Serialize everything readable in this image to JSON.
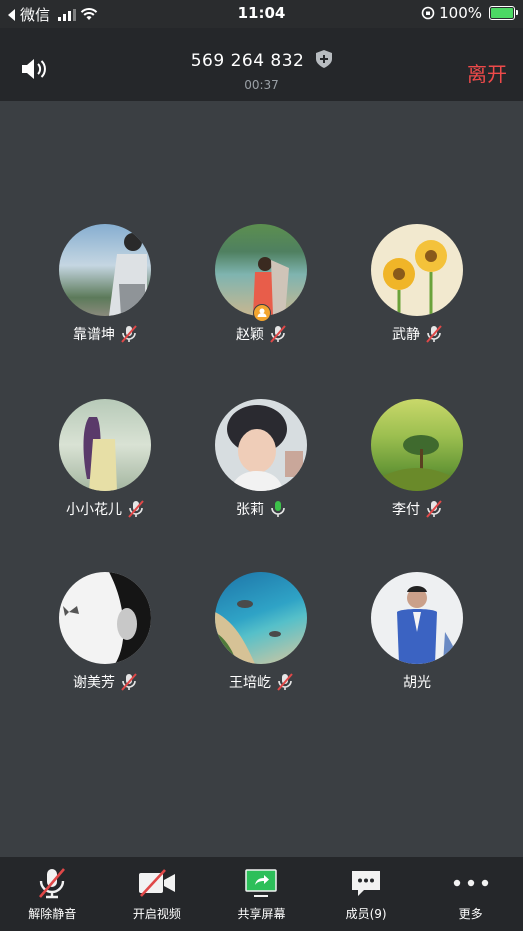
{
  "status_bar": {
    "back_label": "微信",
    "time": "11:04",
    "battery": "100%"
  },
  "header": {
    "meeting_id": "569 264 832",
    "duration": "00:37",
    "leave_label": "离开"
  },
  "participants": [
    {
      "name": "靠谱坤",
      "mic": "muted",
      "avatar_colors": [
        "#7fa6c8",
        "#d9dde0"
      ]
    },
    {
      "name": "赵颖",
      "mic": "muted",
      "host": true,
      "avatar_colors": [
        "#3e8f7d",
        "#c9b68c"
      ]
    },
    {
      "name": "武静",
      "mic": "muted",
      "avatar_colors": [
        "#f4e6b8",
        "#e8b23a"
      ]
    },
    {
      "name": "小小花儿",
      "mic": "muted",
      "avatar_colors": [
        "#9bb7a8",
        "#e6e4dd"
      ]
    },
    {
      "name": "张莉",
      "mic": "active",
      "avatar_colors": [
        "#2f2f36",
        "#e8c7b2"
      ]
    },
    {
      "name": "李付",
      "mic": "muted",
      "avatar_colors": [
        "#a9c35a",
        "#5f8a34"
      ]
    },
    {
      "name": "谢美芳",
      "mic": "muted",
      "avatar_colors": [
        "#f2f2f2",
        "#1d1d1d"
      ]
    },
    {
      "name": "王培屹",
      "mic": "muted",
      "avatar_colors": [
        "#2e8fb8",
        "#d9c9a3"
      ]
    },
    {
      "name": "胡光",
      "mic": "none",
      "avatar_colors": [
        "#eef0f2",
        "#3a5fb8"
      ]
    }
  ],
  "toolbar": {
    "unmute": "解除静音",
    "start_video": "开启视频",
    "share_screen": "共享屏幕",
    "members": "成员(9)",
    "more": "更多"
  },
  "colors": {
    "background": "#3b3f43",
    "bar": "#25272a",
    "leave": "#ee4a4a",
    "muted_slash": "#e04848",
    "active_mic": "#3cc24a",
    "share_green": "#2dbf5a",
    "host_badge": "#f3a530"
  }
}
